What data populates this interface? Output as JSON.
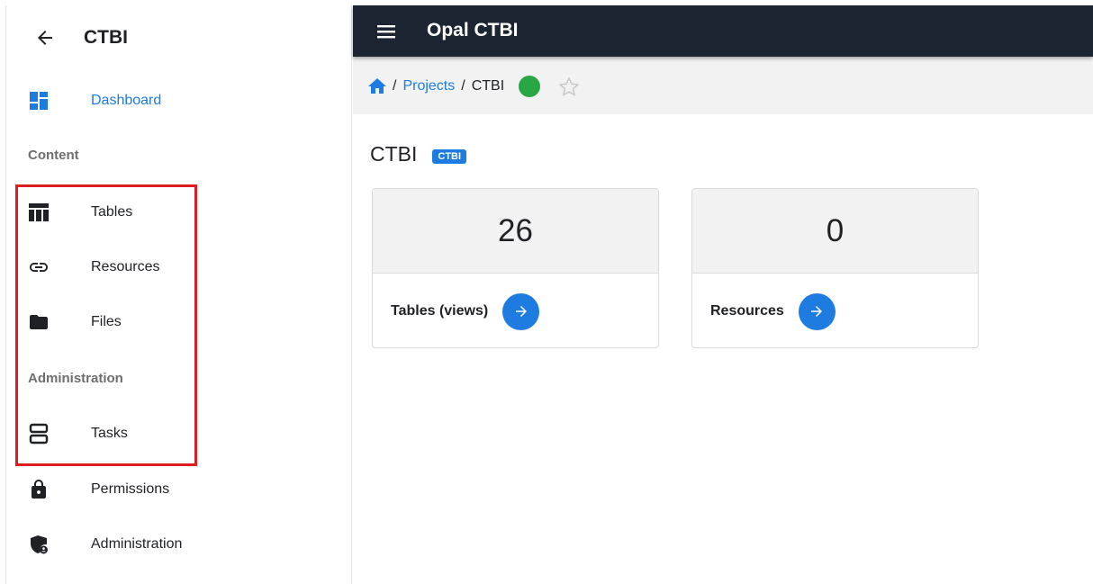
{
  "sidebar": {
    "title": "CTBI",
    "items": [
      {
        "label": "Dashboard",
        "icon": "dashboard-icon"
      },
      {
        "label": "Tables",
        "icon": "table-icon"
      },
      {
        "label": "Resources",
        "icon": "link-icon"
      },
      {
        "label": "Files",
        "icon": "folder-icon"
      },
      {
        "label": "Tasks",
        "icon": "tasks-icon"
      },
      {
        "label": "Permissions",
        "icon": "lock-icon"
      },
      {
        "label": "Administration",
        "icon": "admin-shield-icon"
      }
    ],
    "sections": {
      "content": "Content",
      "administration": "Administration"
    }
  },
  "topbar": {
    "app_title": "Opal CTBI"
  },
  "breadcrumb": {
    "home_icon": "home-icon",
    "projects": "Projects",
    "current": "CTBI",
    "separator": "/"
  },
  "page": {
    "title": "CTBI",
    "badge": "CTBI"
  },
  "cards": [
    {
      "value": "26",
      "label": "Tables (views)"
    },
    {
      "value": "0",
      "label": "Resources"
    }
  ],
  "colors": {
    "accent": "#1e7ce0",
    "topbar": "#1c2331",
    "status_ok": "#2aa745",
    "highlight": "#dd1d22"
  }
}
